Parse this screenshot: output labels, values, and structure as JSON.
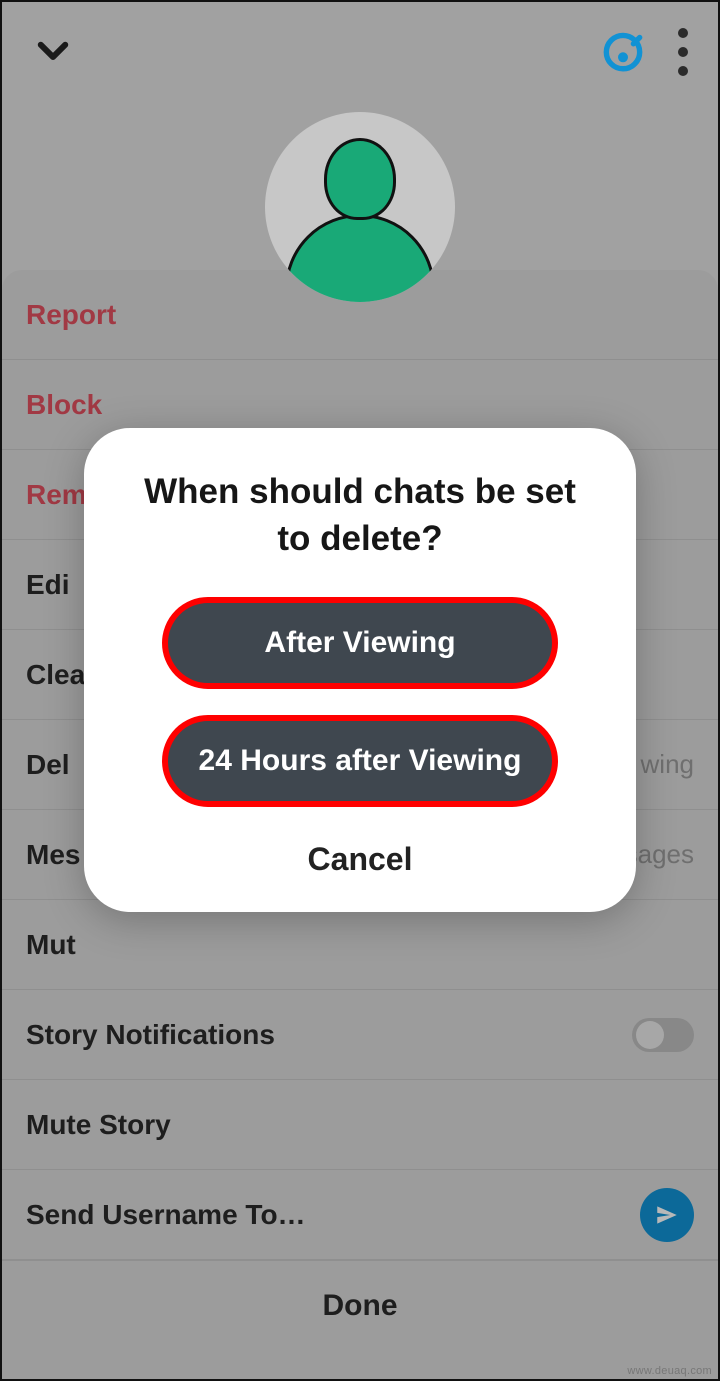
{
  "header": {
    "back_icon": "chevron-down",
    "charm_icon": "charm-check",
    "more_icon": "more-vertical"
  },
  "sheet": {
    "items": [
      {
        "label": "Report",
        "danger": true
      },
      {
        "label": "Block",
        "danger": true
      },
      {
        "label": "Remove Friend",
        "danger": true,
        "truncated": "Rem"
      },
      {
        "label": "Edit Name",
        "truncated": "Edi"
      },
      {
        "label": "Clear Conversation",
        "truncated": "Clea"
      },
      {
        "label": "Delete Chats…",
        "trail": "After Viewing",
        "truncated": "Del",
        "trail_truncated": "wing"
      },
      {
        "label": "Message Notifications",
        "trail": "All Messages",
        "truncated": "Mes",
        "trail_truncated": "sages"
      },
      {
        "label": "Mute Game and Mini Notifications",
        "truncated": "Mut"
      },
      {
        "label": "Story Notifications",
        "toggle": false
      },
      {
        "label": "Mute Story"
      },
      {
        "label": "Send Username To…",
        "send": true
      }
    ],
    "done": "Done"
  },
  "dialog": {
    "title": "When should chats be set to delete?",
    "option1": "After Viewing",
    "option2": "24 Hours after Viewing",
    "cancel": "Cancel"
  },
  "watermark": "www.deuaq.com"
}
